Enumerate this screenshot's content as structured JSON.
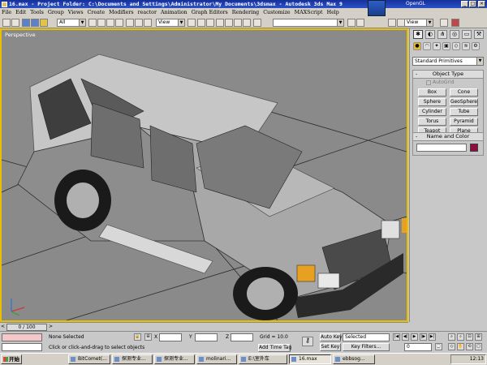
{
  "window": {
    "title": "16.max   - Project Folder: C:\\Documents and Settings\\Administrator\\My Documents\\3dsmax   - Autodesk 3ds Max 9",
    "renderer": "OpenGL"
  },
  "menu": [
    "File",
    "Edit",
    "Tools",
    "Group",
    "Views",
    "Create",
    "Modifiers",
    "reactor",
    "Animation",
    "Graph Editors",
    "Rendering",
    "Customize",
    "MAXScript",
    "Help"
  ],
  "toolbar": {
    "selection_filter": "All",
    "reference_coord": "View",
    "named_selection": "",
    "view_dropdown": "View"
  },
  "viewport": {
    "label": "Perspective"
  },
  "command_panel": {
    "category": "Standard Primitives",
    "object_type_header": "Object Type",
    "autogrid_label": "AutoGrid",
    "primitives": [
      "Box",
      "Cone",
      "Sphere",
      "GeoSphere",
      "Cylinder",
      "Tube",
      "Torus",
      "Pyramid",
      "Teapot",
      "Plane"
    ],
    "name_color_header": "Name and Color",
    "object_color": "#8b1040"
  },
  "timeline": {
    "frame_display": "0 / 100"
  },
  "status": {
    "selection_info": "None Selected",
    "prompt": "Click or click-and-drag to select objects",
    "x_label": "X",
    "y_label": "Y",
    "z_label": "Z",
    "grid": "Grid = 10.0",
    "add_time_tag": "Add Time Tag",
    "auto_key": "Auto Key",
    "set_key": "Set Key",
    "key_selection": "Selected",
    "key_filters": "Key Filters...",
    "current_frame": "0"
  },
  "taskbar": {
    "start": "开始",
    "items": [
      "BitComet(...",
      "探测专业...",
      "探测专业...",
      "molinari...",
      "E:\\室外车",
      "16.max",
      "ebbsog..."
    ],
    "clock": "12:13"
  }
}
